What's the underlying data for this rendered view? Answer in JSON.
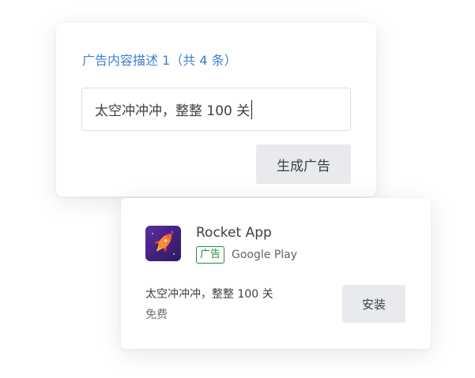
{
  "editor": {
    "title": "广告内容描述 1（共 4 条）",
    "description_value": "太空冲冲冲，整整 100 关",
    "generate_button_label": "生成广告"
  },
  "preview": {
    "app_name": "Rocket App",
    "ad_badge": "广告",
    "store": "Google Play",
    "description": "太空冲冲冲，整整 100 关",
    "price": "免费",
    "install_button_label": "安装",
    "icon": "rocket-icon"
  },
  "colors": {
    "title_blue": "#3d7fd1",
    "badge_green": "#1e8e3e",
    "button_gray": "#e8eaed",
    "icon_background": "#4a2a8c"
  }
}
